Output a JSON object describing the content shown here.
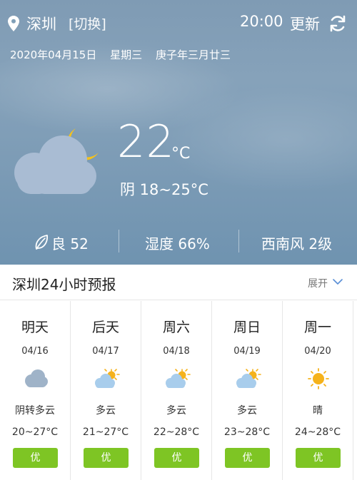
{
  "header": {
    "city": "深圳",
    "switch_label": "[切换]",
    "time": "20:00",
    "update_label": "更新"
  },
  "dateline": {
    "date": "2020年04月15日",
    "weekday": "星期三",
    "lunar": "庚子年三月廿三"
  },
  "current": {
    "icon": "cloud-moon-icon",
    "temperature": "22",
    "unit": "°C",
    "condition": "阴 18~25°C"
  },
  "stats": {
    "air_quality": "良 52",
    "humidity": "湿度 66%",
    "wind": "西南风 2级"
  },
  "forecast": {
    "title": "深圳24小时预报",
    "expand_label": "展开",
    "days": [
      {
        "name": "明天",
        "date": "04/16",
        "icon": "cloudy-icon",
        "desc": "阴转多云",
        "temp": "20~27°C",
        "aqi": "优"
      },
      {
        "name": "后天",
        "date": "04/17",
        "icon": "partly-cloudy-icon",
        "desc": "多云",
        "temp": "21~27°C",
        "aqi": "优"
      },
      {
        "name": "周六",
        "date": "04/18",
        "icon": "partly-cloudy-icon",
        "desc": "多云",
        "temp": "22~28°C",
        "aqi": "优"
      },
      {
        "name": "周日",
        "date": "04/19",
        "icon": "partly-cloudy-icon",
        "desc": "多云",
        "temp": "23~28°C",
        "aqi": "优"
      },
      {
        "name": "周一",
        "date": "04/20",
        "icon": "sunny-icon",
        "desc": "晴",
        "temp": "24~28°C",
        "aqi": "优"
      }
    ]
  },
  "colors": {
    "sky": "#7f9bb4",
    "aqi_good": "#7ec524",
    "sun": "#f5b21b",
    "cloud": "#a8c8e8"
  }
}
